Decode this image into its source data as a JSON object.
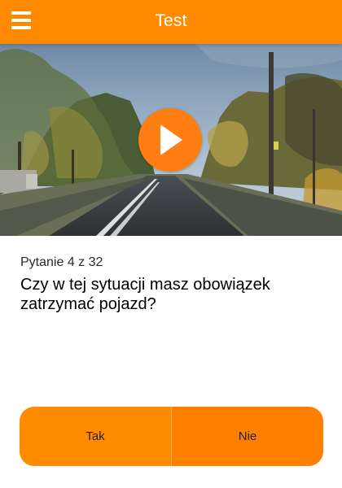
{
  "header": {
    "title": "Test",
    "menu_icon": "hamburger-menu-icon"
  },
  "video": {
    "play_icon": "play-icon"
  },
  "question": {
    "counter": "Pytanie 4 z 32",
    "text": "Czy w tej sytuacji masz obowiązek zatrzymać pojazd?"
  },
  "answers": {
    "yes_label": "Tak",
    "no_label": "Nie"
  },
  "colors": {
    "accent": "#FF8A00",
    "button_left": "#FF8C00",
    "button_right": "#FF7F00",
    "play": "#FF7E12"
  }
}
